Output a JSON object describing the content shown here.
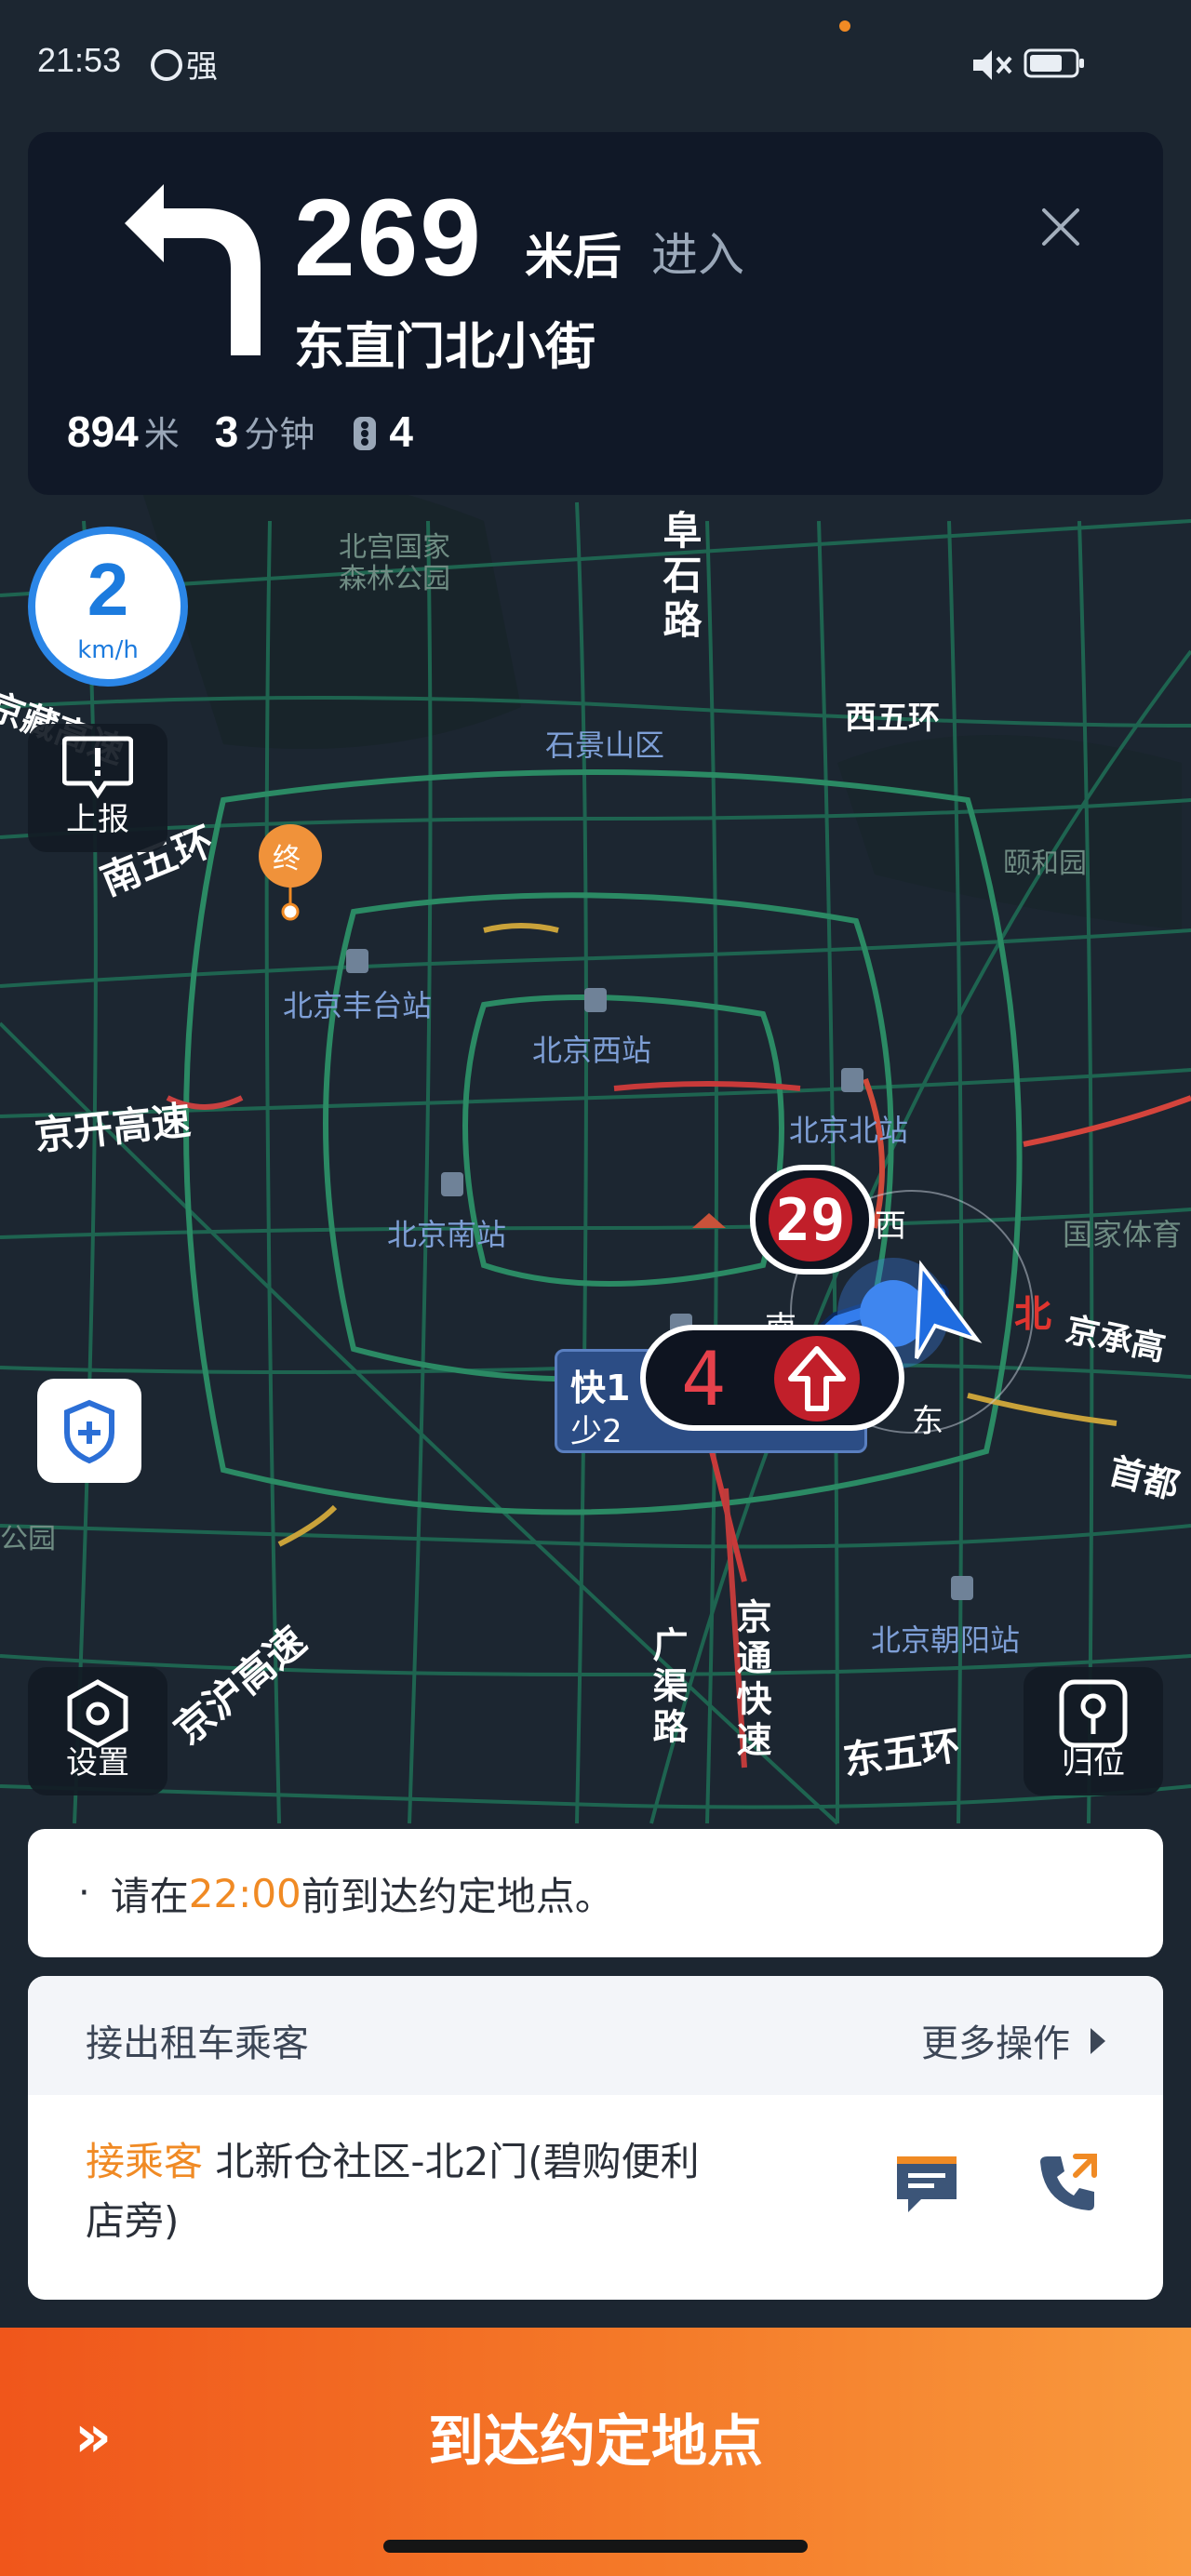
{
  "status_bar": {
    "time": "21:53",
    "signal_text": "强"
  },
  "navigation": {
    "distance": "269",
    "distance_unit": "米后",
    "action": "进入",
    "road": "东直门北小街",
    "remaining_distance": "894",
    "remaining_distance_unit": "米",
    "remaining_time": "3",
    "remaining_time_unit": "分钟",
    "traffic_lights": "4",
    "turn_direction": "turn-left"
  },
  "speed": {
    "value": "2",
    "unit": "km/h"
  },
  "buttons": {
    "report": "上报",
    "settings": "设置",
    "recenter": "归位"
  },
  "map_labels": {
    "forest_park": "北宫国家\n森林公园",
    "fushi_road": "阜石路",
    "west_5th_ring": "西五环",
    "shijingshan": "石景山区",
    "summer_palace": "颐和园",
    "jingzang": "京藏高速",
    "south_5th_ring": "南五环",
    "destination_marker": "终",
    "fengtai_station": "北京丰台站",
    "west_station": "北京西站",
    "north_station": "北京北站",
    "jingkai": "京开高速",
    "south_station": "北京南站",
    "national_stadium": "国家体育",
    "jingcheng": "京承高",
    "capital": "首都",
    "bei_glyph": "北",
    "park": "公园",
    "jinghu": "京沪高速",
    "guangqu": "广渠路",
    "jingtong": "京通快速",
    "chaoyang_station": "北京朝阳站",
    "east_5th_ring": "东五环",
    "east": "东",
    "west": "西",
    "south": "南"
  },
  "signals": {
    "countdown_red": "29",
    "countdown_arrow": "4"
  },
  "fast_lane_box": {
    "line1": "快1",
    "line2": "少2"
  },
  "notice": {
    "prefix": "请在",
    "time": "22:00",
    "suffix": "前到达约定地点。"
  },
  "passenger": {
    "title": "接出租车乘客",
    "more_actions": "更多操作",
    "pickup_label": "接乘客",
    "pickup_address": "北新仓社区-北2门(碧购便利店旁)"
  },
  "arrive_button": {
    "label": "到达约定地点",
    "icon": "double-chevron-right"
  },
  "colors": {
    "accent_orange": "#f08a24",
    "nav_bg": "#101827",
    "speed_blue": "#2b86e7",
    "signal_red": "#c11f2a"
  }
}
